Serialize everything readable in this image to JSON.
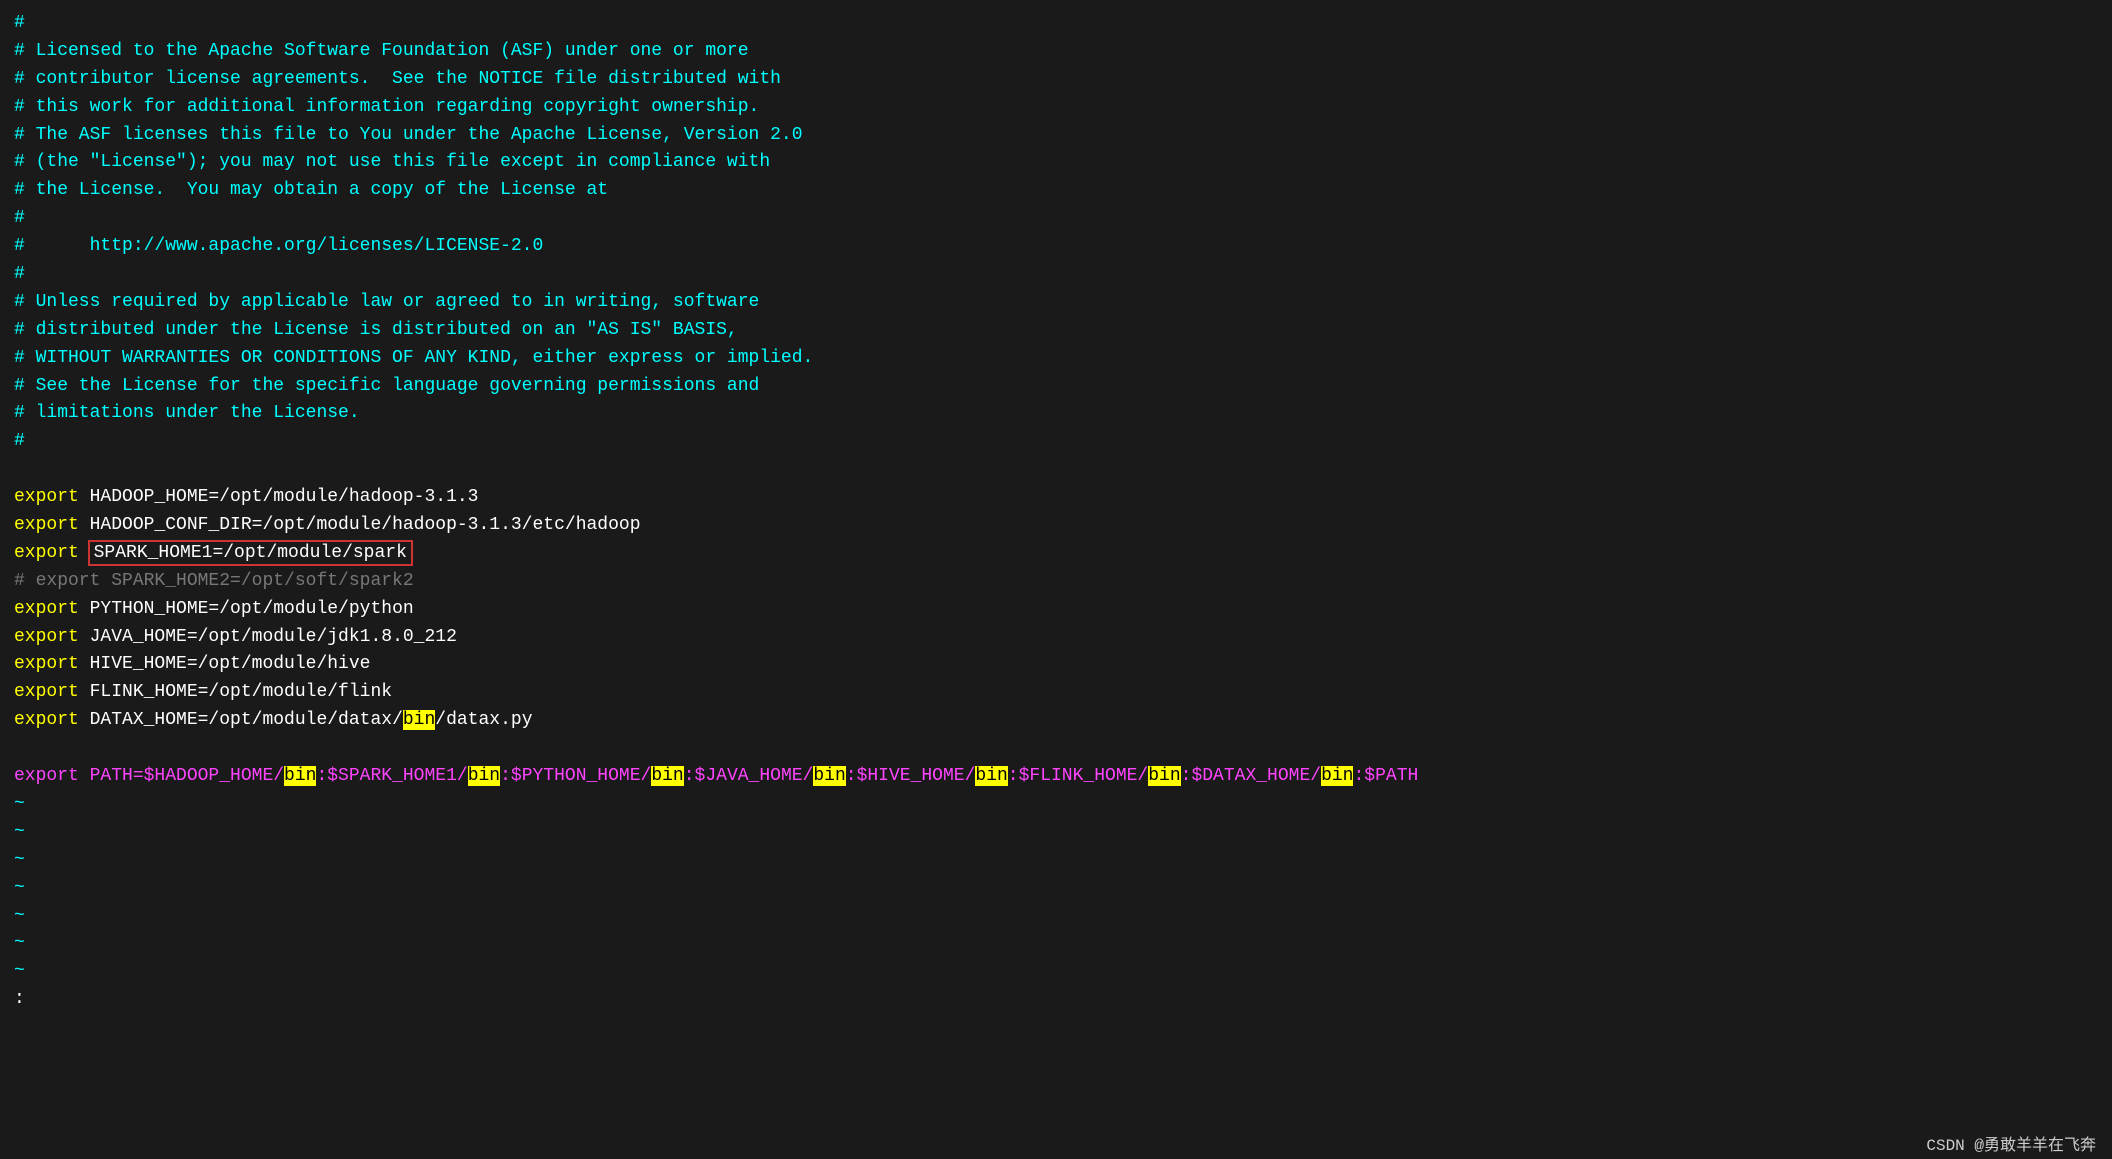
{
  "terminal": {
    "background": "#1a1a1a",
    "lines": [
      {
        "type": "comment",
        "text": "#"
      },
      {
        "type": "comment",
        "text": "# Licensed to the Apache Software Foundation (ASF) under one or more"
      },
      {
        "type": "comment",
        "text": "# contributor license agreements.  See the NOTICE file distributed with"
      },
      {
        "type": "comment",
        "text": "# this work for additional information regarding copyright ownership."
      },
      {
        "type": "comment",
        "text": "# The ASF licenses this file to You under the Apache License, Version 2.0"
      },
      {
        "type": "comment",
        "text": "# (the \"License\"); you may not use this file except in compliance with"
      },
      {
        "type": "comment",
        "text": "# the License.  You may obtain a copy of the License at"
      },
      {
        "type": "comment",
        "text": "#"
      },
      {
        "type": "comment",
        "text": "#      http://www.apache.org/licenses/LICENSE-2.0"
      },
      {
        "type": "comment",
        "text": "#"
      },
      {
        "type": "comment",
        "text": "# Unless required by applicable law or agreed to in writing, software"
      },
      {
        "type": "comment",
        "text": "# distributed under the License is distributed on an \"AS IS\" BASIS,"
      },
      {
        "type": "comment",
        "text": "# WITHOUT WARRANTIES OR CONDITIONS OF ANY KIND, either express or implied."
      },
      {
        "type": "comment",
        "text": "# See the License for the specific language governing permissions and"
      },
      {
        "type": "comment",
        "text": "# limitations under the License."
      },
      {
        "type": "comment",
        "text": "#"
      },
      {
        "type": "blank",
        "text": ""
      },
      {
        "type": "export",
        "keyword": "export",
        "varname": "HADOOP_HOME",
        "value": "/opt/module/hadoop-3.1.3"
      },
      {
        "type": "export",
        "keyword": "export",
        "varname": "HADOOP_CONF_DIR",
        "value": "/opt/module/hadoop-3.1.3/etc/hadoop"
      },
      {
        "type": "export_selected",
        "keyword": "export",
        "varname": "SPARK_HOME1",
        "value": "/opt/module/spark"
      },
      {
        "type": "commented_export",
        "text": "# export SPARK_HOME2=/opt/soft/spark2"
      },
      {
        "type": "export",
        "keyword": "export",
        "varname": "PYTHON_HOME",
        "value": "/opt/module/python"
      },
      {
        "type": "export",
        "keyword": "export",
        "varname": "JAVA_HOME",
        "value": "/opt/module/jdk1.8.0_212"
      },
      {
        "type": "export",
        "keyword": "export",
        "varname": "HIVE_HOME",
        "value": "/opt/module/hive"
      },
      {
        "type": "export",
        "keyword": "export",
        "varname": "FLINK_HOME",
        "value": "/opt/module/flink"
      },
      {
        "type": "export_bin",
        "keyword": "export",
        "varname": "DATAX_HOME",
        "value": "/opt/module/datax/",
        "bin": "bin",
        "rest": "/datax.py"
      },
      {
        "type": "blank",
        "text": ""
      },
      {
        "type": "path_line",
        "parts": [
          {
            "text": "export PATH=$HADOOP_HOME/",
            "color": "magenta"
          },
          {
            "text": "bin",
            "highlight": true
          },
          {
            "text": ":$SPARK_HOME1/",
            "color": "magenta"
          },
          {
            "text": "bin",
            "highlight": true
          },
          {
            "text": ":$PYTHON_HOME/",
            "color": "magenta"
          },
          {
            "text": "bin",
            "highlight": true
          },
          {
            "text": ":$JAVA_HOME/",
            "color": "magenta"
          },
          {
            "text": "bin",
            "highlight": true
          },
          {
            "text": ":$HIVE_HOME/",
            "color": "magenta"
          },
          {
            "text": "bin",
            "highlight": true
          },
          {
            "text": ":$FLINK_HOME/",
            "color": "magenta"
          },
          {
            "text": "bin",
            "highlight": true
          },
          {
            "text": ":$DATAX_HOME/",
            "color": "magenta"
          },
          {
            "text": "bin",
            "highlight": true
          },
          {
            "text": ":$PATH",
            "color": "magenta"
          }
        ]
      },
      {
        "type": "tilde",
        "text": "~"
      },
      {
        "type": "tilde",
        "text": "~"
      },
      {
        "type": "tilde",
        "text": "~"
      },
      {
        "type": "tilde",
        "text": "~"
      },
      {
        "type": "tilde",
        "text": "~"
      },
      {
        "type": "tilde",
        "text": "~"
      },
      {
        "type": "tilde",
        "text": "~"
      },
      {
        "type": "cursor",
        "text": ":"
      }
    ],
    "bottom_bar": "CSDN @勇敢羊羊在飞奔"
  }
}
